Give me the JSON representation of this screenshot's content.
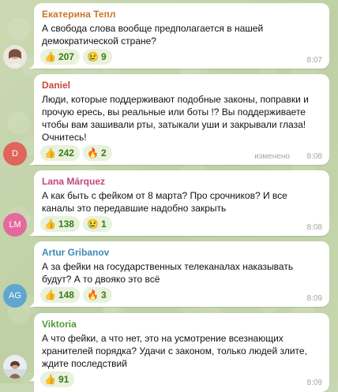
{
  "messages": [
    {
      "author": "Екатерина Тепл",
      "author_color": "#c9772a",
      "avatar_kind": "photo",
      "text": "А свобода слова вообще предполагается в нашей демократической стране?",
      "reactions": [
        {
          "emoji": "👍",
          "count": "207"
        },
        {
          "emoji": "😢",
          "count": "9"
        }
      ],
      "time": "8:07",
      "edited": ""
    },
    {
      "author": "Daniel",
      "author_color": "#c44a3f",
      "avatar_kind": "initials",
      "avatar_text": "D",
      "avatar_color": "#e0655a",
      "text": "Люди, которые поддерживают подобные законы, поправки и прочую ересь, вы реальные или боты !? Вы поддерживаете чтобы вам зашивали рты, затыкали уши и закрывали глаза! Очнитесь!",
      "reactions": [
        {
          "emoji": "👍",
          "count": "242"
        },
        {
          "emoji": "🔥",
          "count": "2"
        }
      ],
      "time": "8:08",
      "edited": "изменено"
    },
    {
      "author": "Lana Márquez",
      "author_color": "#c0477e",
      "avatar_kind": "initials",
      "avatar_text": "LM",
      "avatar_color": "#e36a9d",
      "text": "А как быть с фейком от 8 марта? Про срочников? И все каналы это передавшие надобно закрыть",
      "reactions": [
        {
          "emoji": "👍",
          "count": "138"
        },
        {
          "emoji": "😢",
          "count": "1"
        }
      ],
      "time": "8:08",
      "edited": ""
    },
    {
      "author": "Artur Gribanov",
      "author_color": "#3d8ab2",
      "avatar_kind": "initials",
      "avatar_text": "AG",
      "avatar_color": "#5fa7cf",
      "text": "А за фейки на государственных телеканалах наказывать будут? А то двояко это всё",
      "reactions": [
        {
          "emoji": "👍",
          "count": "148"
        },
        {
          "emoji": "🔥",
          "count": "3"
        }
      ],
      "time": "8:09",
      "edited": ""
    },
    {
      "author": "Viktoria",
      "author_color": "#4f9a35",
      "avatar_kind": "photo",
      "text": "А что фейки, а что нет, это на усмотрение всезнающих хранителей порядка? Удачи с законом, только людей злите, ждите последствий",
      "reactions": [
        {
          "emoji": "👍",
          "count": "91"
        }
      ],
      "time": "8:09",
      "edited": ""
    }
  ]
}
